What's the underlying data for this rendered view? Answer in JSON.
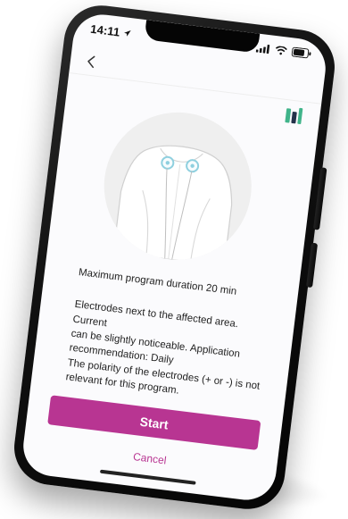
{
  "status_bar": {
    "time": "14:11",
    "location_icon": "location-arrow-icon",
    "signal_icon": "cellular-signal-icon",
    "wifi_icon": "wifi-icon",
    "battery_icon": "battery-icon"
  },
  "nav": {
    "back_icon": "chevron-left-icon",
    "logo_icon": "app-logo-icon"
  },
  "program": {
    "duration_text": "Maximum program duration 20 min",
    "description_lines": [
      "Electrodes next to the affected area. Current",
      "can be slightly noticeable. Application",
      "recommendation: Daily",
      "The polarity of the electrodes (+ or -) is not",
      "relevant for this program."
    ]
  },
  "actions": {
    "start_label": "Start",
    "cancel_label": "Cancel"
  },
  "colors": {
    "accent": "#b83592",
    "screen_bg": "#fbfbfd",
    "figure_bg": "#efefef",
    "electrode": "#8fd0df",
    "logo_green": "#40b48a",
    "logo_dark": "#24324a"
  }
}
